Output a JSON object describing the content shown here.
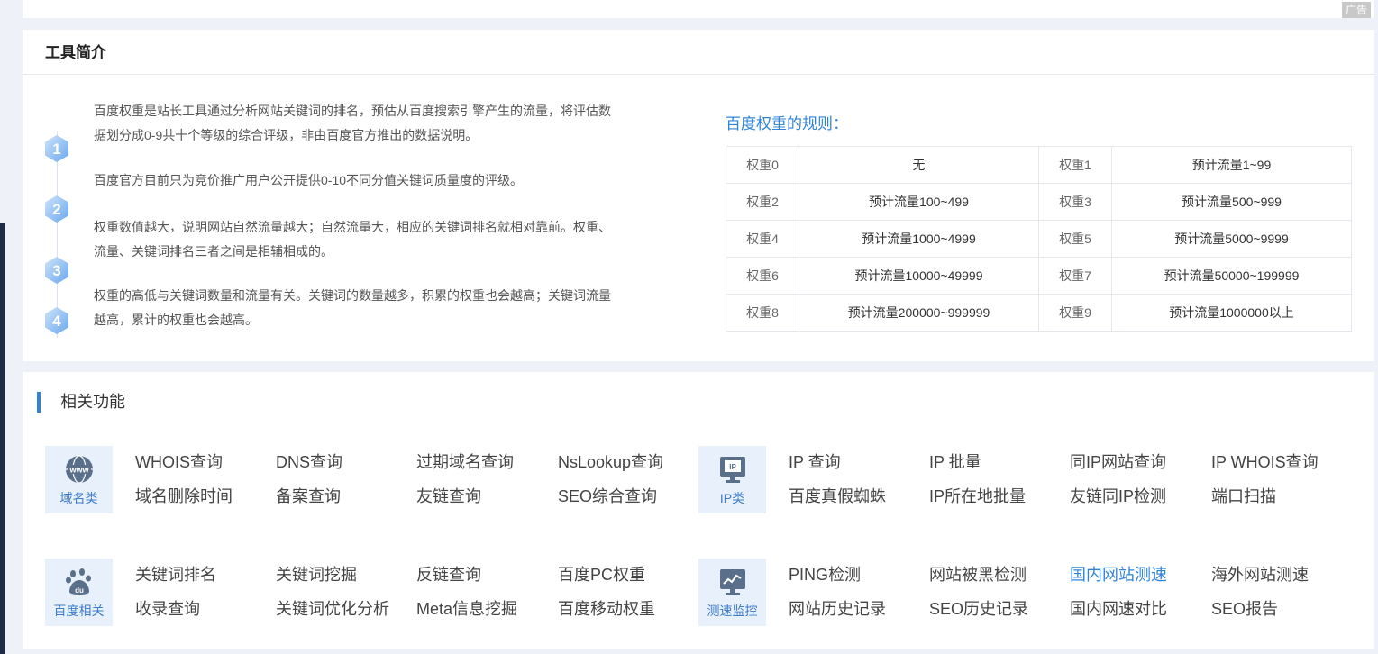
{
  "ad_badge": "广告",
  "intro": {
    "title": "工具简介",
    "steps": [
      {
        "num": "1",
        "text": "百度权重是站长工具通过分析网站关键词的排名，预估从百度搜索引擎产生的流量，将评估数据划分成0-9共十个等级的综合评级，非由百度官方推出的数据说明。"
      },
      {
        "num": "2",
        "text": "百度官方目前只为竞价推广用户公开提供0-10不同分值关键词质量度的评级。"
      },
      {
        "num": "3",
        "text": "权重数值越大，说明网站自然流量越大；自然流量大，相应的关键词排名就相对靠前。权重、流量、关键词排名三者之间是相辅相成的。"
      },
      {
        "num": "4",
        "text": "权重的高低与关键词数量和流量有关。关键词的数量越多，积累的权重也会越高；关键词流量越高，累计的权重也会越高。"
      }
    ],
    "rules_title": "百度权重的规则：",
    "rules": [
      [
        "权重0",
        "无",
        "权重1",
        "预计流量1~99"
      ],
      [
        "权重2",
        "预计流量100~499",
        "权重3",
        "预计流量500~999"
      ],
      [
        "权重4",
        "预计流量1000~4999",
        "权重5",
        "预计流量5000~9999"
      ],
      [
        "权重6",
        "预计流量10000~49999",
        "权重7",
        "预计流量50000~199999"
      ],
      [
        "权重8",
        "预计流量200000~999999",
        "权重9",
        "预计流量1000000以上"
      ]
    ]
  },
  "related": {
    "title": "相关功能",
    "groups": [
      {
        "label": "域名类",
        "icon": "www-globe-icon",
        "links": [
          "WHOIS查询",
          "DNS查询",
          "过期域名查询",
          "NsLookup查询",
          "域名删除时间",
          "备案查询",
          "友链查询",
          "SEO综合查询"
        ]
      },
      {
        "label": "IP类",
        "icon": "ip-monitor-icon",
        "links": [
          "IP 查询",
          "IP 批量",
          "同IP网站查询",
          "IP WHOIS查询",
          "百度真假蜘蛛",
          "IP所在地批量",
          "友链同IP检测",
          "端口扫描"
        ]
      },
      {
        "label": "百度相关",
        "icon": "baidu-paw-icon",
        "links": [
          "关键词排名",
          "关键词挖掘",
          "反链查询",
          "百度PC权重",
          "收录查询",
          "关键词优化分析",
          "Meta信息挖掘",
          "百度移动权重"
        ]
      },
      {
        "label": "测速监控",
        "icon": "speed-monitor-icon",
        "links": [
          "PING检测",
          "网站被黑检测",
          "国内网站测速",
          "海外网站测速",
          "网站历史记录",
          "SEO历史记录",
          "国内网速对比",
          "SEO报告"
        ]
      }
    ],
    "active_link": "国内网站测速",
    "accent_color": "#2f84d8"
  }
}
